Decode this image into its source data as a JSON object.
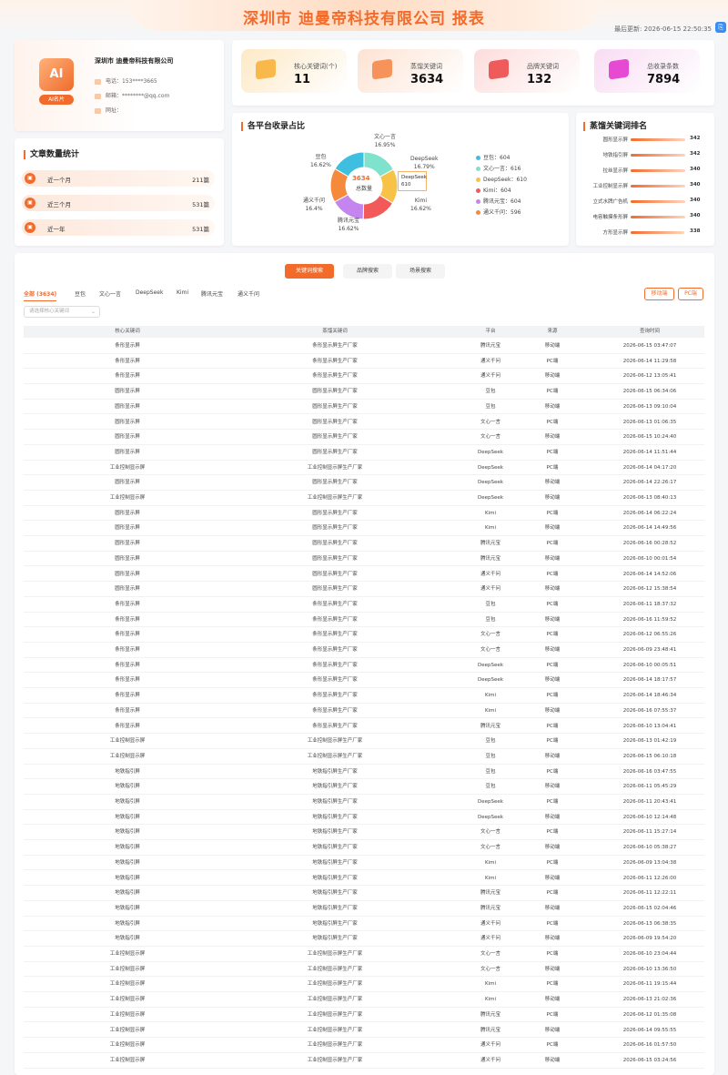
{
  "header": {
    "title": "深圳市 迪曼帝科技有限公司 报表",
    "updated": "最后更新: 2026-06-15 22:50:35"
  },
  "company": {
    "badge": "AI",
    "card_label": "AI名片",
    "name": "深圳市 迪曼帝科技有限公司",
    "phone": "电话：153****3665",
    "email": "邮箱：********@qq.com",
    "website": "网址："
  },
  "stats": [
    {
      "label": "核心关键词(个)",
      "value": "11",
      "color": "#fde9c6",
      "icon": "#f9b84a"
    },
    {
      "label": "蒸馏关键词",
      "value": "3634",
      "color": "#fde3d3",
      "icon": "#f6935a"
    },
    {
      "label": "品牌关键词",
      "value": "132",
      "color": "#fddcdc",
      "icon": "#ef5b5b"
    },
    {
      "label": "总收录条数",
      "value": "7894",
      "color": "#f9dcf3",
      "icon": "#e64ad2"
    }
  ],
  "articles": {
    "title": "文章数量统计",
    "rows": [
      {
        "label": "近一个月",
        "value": "211篇"
      },
      {
        "label": "近三个月",
        "value": "531篇"
      },
      {
        "label": "近一年",
        "value": "531篇"
      }
    ]
  },
  "chart_data": {
    "type": "pie",
    "title": "各平台收录占比",
    "center_value": "3634",
    "center_label": "总数量",
    "categories": [
      "豆包",
      "文心一言",
      "DeepSeek",
      "Kimi",
      "腾讯元宝",
      "通义千问"
    ],
    "values": [
      604,
      616,
      610,
      604,
      604,
      596
    ],
    "percent_labels": [
      "16.62%",
      "16.95%",
      "16.79%",
      "16.62%",
      "16.62%",
      "16.4%"
    ],
    "colors": [
      "#3fbfe0",
      "#7fe2cc",
      "#f8c246",
      "#f25a5a",
      "#c585ef",
      "#f58a3c"
    ],
    "legend": [
      "豆包：604",
      "文心一言：616",
      "DeepSeek：610",
      "Kimi：604",
      "腾讯元宝：604",
      "通义千问：596"
    ],
    "tooltip": {
      "name": "DeepSeek",
      "value": "610"
    },
    "legend_position": "right"
  },
  "ranking": {
    "title": "蒸馏关键词排名",
    "max": 342,
    "rows": [
      {
        "label": "圆形显示屏",
        "value": 342
      },
      {
        "label": "地铁指引屏",
        "value": 342
      },
      {
        "label": "拉丝显示屏",
        "value": 340
      },
      {
        "label": "工业控制显示屏",
        "value": 340
      },
      {
        "label": "立式水牌广告机",
        "value": 340
      },
      {
        "label": "电容触摸条形屏",
        "value": 340
      },
      {
        "label": "方形显示屏",
        "value": 338
      }
    ]
  },
  "search_tabs": [
    {
      "label": "关键词搜索",
      "active": true
    },
    {
      "label": "品牌搜索",
      "active": false
    },
    {
      "label": "场景搜索",
      "active": false
    }
  ],
  "platform_tabs": [
    "全部 (3634)",
    "豆包",
    "文心一言",
    "DeepSeek",
    "Kimi",
    "腾讯元宝",
    "通义千问"
  ],
  "device_buttons": [
    "移动端",
    "PC端"
  ],
  "filter": {
    "placeholder": "请选择核心关键词"
  },
  "table": {
    "headers": [
      "核心关键词",
      "蒸馏关键词",
      "平台",
      "来源",
      "查询时间"
    ],
    "rows": [
      [
        "条形显示屏",
        "条形显示屏生产厂家",
        "腾讯元宝",
        "移动端",
        "2026-06-15 03:47:07"
      ],
      [
        "条形显示屏",
        "条形显示屏生产厂家",
        "通义千问",
        "PC端",
        "2026-06-14 11:29:58"
      ],
      [
        "条形显示屏",
        "条形显示屏生产厂家",
        "通义千问",
        "移动端",
        "2026-06-12 13:05:41"
      ],
      [
        "圆形显示屏",
        "圆形显示屏生产厂家",
        "豆包",
        "PC端",
        "2026-06-15 06:34:06"
      ],
      [
        "圆形显示屏",
        "圆形显示屏生产厂家",
        "豆包",
        "移动端",
        "2026-06-13 09:10:04"
      ],
      [
        "圆形显示屏",
        "圆形显示屏生产厂家",
        "文心一言",
        "PC端",
        "2026-06-13 01:06:35"
      ],
      [
        "圆形显示屏",
        "圆形显示屏生产厂家",
        "文心一言",
        "移动端",
        "2026-06-15 10:24:40"
      ],
      [
        "圆形显示屏",
        "圆形显示屏生产厂家",
        "DeepSeek",
        "PC端",
        "2026-06-14 11:51:44"
      ],
      [
        "工业控制显示屏",
        "工业控制显示屏生产厂家",
        "DeepSeek",
        "PC端",
        "2026-06-14 04:17:20"
      ],
      [
        "圆形显示屏",
        "圆形显示屏生产厂家",
        "DeepSeek",
        "移动端",
        "2026-06-14 22:26:17"
      ],
      [
        "工业控制显示屏",
        "工业控制显示屏生产厂家",
        "DeepSeek",
        "移动端",
        "2026-06-13 08:40:13"
      ],
      [
        "圆形显示屏",
        "圆形显示屏生产厂家",
        "Kimi",
        "PC端",
        "2026-06-14 06:22:24"
      ],
      [
        "圆形显示屏",
        "圆形显示屏生产厂家",
        "Kimi",
        "移动端",
        "2026-06-14 14:49:56"
      ],
      [
        "圆形显示屏",
        "圆形显示屏生产厂家",
        "腾讯元宝",
        "PC端",
        "2026-06-16 00:28:52"
      ],
      [
        "圆形显示屏",
        "圆形显示屏生产厂家",
        "腾讯元宝",
        "移动端",
        "2026-06-10 00:01:54"
      ],
      [
        "圆形显示屏",
        "圆形显示屏生产厂家",
        "通义千问",
        "PC端",
        "2026-06-14 14:52:06"
      ],
      [
        "圆形显示屏",
        "圆形显示屏生产厂家",
        "通义千问",
        "移动端",
        "2026-06-12 15:38:54"
      ],
      [
        "条形显示屏",
        "条形显示屏生产厂家",
        "豆包",
        "PC端",
        "2026-06-11 18:37:32"
      ],
      [
        "条形显示屏",
        "条形显示屏生产厂家",
        "豆包",
        "移动端",
        "2026-06-16 11:59:52"
      ],
      [
        "条形显示屏",
        "条形显示屏生产厂家",
        "文心一言",
        "PC端",
        "2026-06-12 06:55:26"
      ],
      [
        "条形显示屏",
        "条形显示屏生产厂家",
        "文心一言",
        "移动端",
        "2026-06-09 23:48:41"
      ],
      [
        "条形显示屏",
        "条形显示屏生产厂家",
        "DeepSeek",
        "PC端",
        "2026-06-10 00:05:51"
      ],
      [
        "条形显示屏",
        "条形显示屏生产厂家",
        "DeepSeek",
        "移动端",
        "2026-06-14 18:17:57"
      ],
      [
        "条形显示屏",
        "条形显示屏生产厂家",
        "Kimi",
        "PC端",
        "2026-06-14 18:46:34"
      ],
      [
        "条形显示屏",
        "条形显示屏生产厂家",
        "Kimi",
        "移动端",
        "2026-06-16 07:55:37"
      ],
      [
        "条形显示屏",
        "条形显示屏生产厂家",
        "腾讯元宝",
        "PC端",
        "2026-06-10 13:04:41"
      ],
      [
        "工业控制显示屏",
        "工业控制显示屏生产厂家",
        "豆包",
        "PC端",
        "2026-06-13 01:42:19"
      ],
      [
        "工业控制显示屏",
        "工业控制显示屏生产厂家",
        "豆包",
        "移动端",
        "2026-06-15 06:10:18"
      ],
      [
        "地铁指引屏",
        "地铁指引屏生产厂家",
        "豆包",
        "PC端",
        "2026-06-16 03:47:55"
      ],
      [
        "地铁指引屏",
        "地铁指引屏生产厂家",
        "豆包",
        "移动端",
        "2026-06-11 05:45:29"
      ],
      [
        "地铁指引屏",
        "地铁指引屏生产厂家",
        "DeepSeek",
        "PC端",
        "2026-06-11 20:43:41"
      ],
      [
        "地铁指引屏",
        "地铁指引屏生产厂家",
        "DeepSeek",
        "移动端",
        "2026-06-10 12:14:48"
      ],
      [
        "地铁指引屏",
        "地铁指引屏生产厂家",
        "文心一言",
        "PC端",
        "2026-06-11 15:27:14"
      ],
      [
        "地铁指引屏",
        "地铁指引屏生产厂家",
        "文心一言",
        "移动端",
        "2026-06-10 05:38:27"
      ],
      [
        "地铁指引屏",
        "地铁指引屏生产厂家",
        "Kimi",
        "PC端",
        "2026-06-09 13:04:38"
      ],
      [
        "地铁指引屏",
        "地铁指引屏生产厂家",
        "Kimi",
        "移动端",
        "2026-06-11 12:26:00"
      ],
      [
        "地铁指引屏",
        "地铁指引屏生产厂家",
        "腾讯元宝",
        "PC端",
        "2026-06-11 12:22:11"
      ],
      [
        "地铁指引屏",
        "地铁指引屏生产厂家",
        "腾讯元宝",
        "移动端",
        "2026-06-15 02:04:46"
      ],
      [
        "地铁指引屏",
        "地铁指引屏生产厂家",
        "通义千问",
        "PC端",
        "2026-06-13 06:38:35"
      ],
      [
        "地铁指引屏",
        "地铁指引屏生产厂家",
        "通义千问",
        "移动端",
        "2026-06-09 19:54:20"
      ],
      [
        "工业控制显示屏",
        "工业控制显示屏生产厂家",
        "文心一言",
        "PC端",
        "2026-06-10 23:04:44"
      ],
      [
        "工业控制显示屏",
        "工业控制显示屏生产厂家",
        "文心一言",
        "移动端",
        "2026-06-10 13:36:50"
      ],
      [
        "工业控制显示屏",
        "工业控制显示屏生产厂家",
        "Kimi",
        "PC端",
        "2026-06-11 19:15:44"
      ],
      [
        "工业控制显示屏",
        "工业控制显示屏生产厂家",
        "Kimi",
        "移动端",
        "2026-06-13 21:02:36"
      ],
      [
        "工业控制显示屏",
        "工业控制显示屏生产厂家",
        "腾讯元宝",
        "PC端",
        "2026-06-12 01:35:08"
      ],
      [
        "工业控制显示屏",
        "工业控制显示屏生产厂家",
        "腾讯元宝",
        "移动端",
        "2026-06-14 09:55:55"
      ],
      [
        "工业控制显示屏",
        "工业控制显示屏生产厂家",
        "通义千问",
        "PC端",
        "2026-06-16 01:57:50"
      ],
      [
        "工业控制显示屏",
        "工业控制显示屏生产厂家",
        "通义千问",
        "移动端",
        "2026-06-15 03:24:56"
      ]
    ]
  }
}
